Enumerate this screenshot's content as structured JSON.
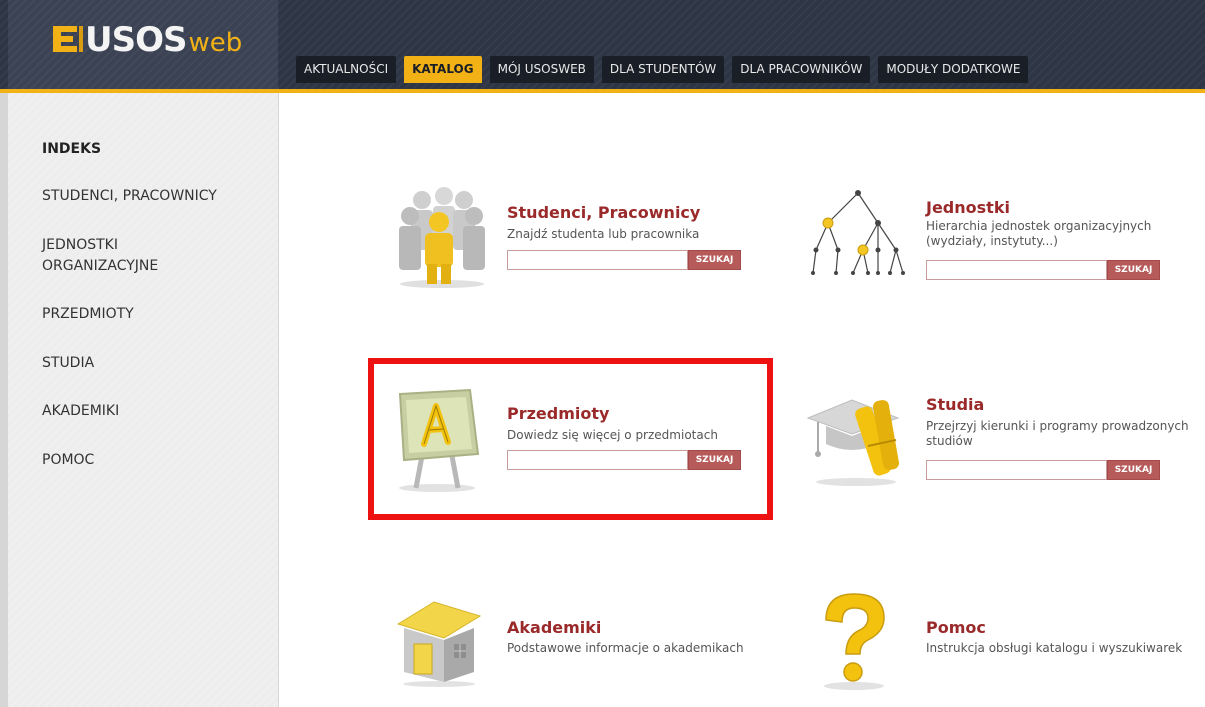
{
  "header": {
    "logo": {
      "main": "USOS",
      "suffix": "web"
    },
    "nav": [
      {
        "label": "AKTUALNOŚCI",
        "active": false
      },
      {
        "label": "KATALOG",
        "active": true
      },
      {
        "label": "MÓJ USOSWEB",
        "active": false
      },
      {
        "label": "DLA STUDENTÓW",
        "active": false
      },
      {
        "label": "DLA PRACOWNIKÓW",
        "active": false
      },
      {
        "label": "MODUŁY DODATKOWE",
        "active": false
      }
    ]
  },
  "sidebar": {
    "items": [
      {
        "label": "INDEKS"
      },
      {
        "label": "STUDENCI, PRACOWNICY"
      },
      {
        "label_line1": "JEDNOSTKI",
        "label_line2": "ORGANIZACYJNE"
      },
      {
        "label": "PRZEDMIOTY"
      },
      {
        "label": "STUDIA"
      },
      {
        "label": "AKADEMIKI"
      },
      {
        "label": "POMOC"
      }
    ]
  },
  "tiles": {
    "studenci": {
      "title": "Studenci, Pracownicy",
      "desc": "Znajdź studenta lub pracownika",
      "search_value": "",
      "button": "SZUKAJ",
      "icon": "people-icon"
    },
    "jednostki": {
      "title": "Jednostki",
      "desc_line1": "Hierarchia jednostek organizacyjnych",
      "desc_line2": "(wydziały, instytuty...)",
      "search_value": "",
      "button": "SZUKAJ",
      "icon": "tree-hierarchy-icon"
    },
    "przedmioty": {
      "title": "Przedmioty",
      "desc": "Dowiedz się więcej o przedmiotach",
      "search_value": "",
      "button": "SZUKAJ",
      "icon": "easel-letter-a-icon"
    },
    "studia": {
      "title": "Studia",
      "desc_line1": "Przejrzyj kierunki i programy prowadzonych",
      "desc_line2": "studiów",
      "search_value": "",
      "button": "SZUKAJ",
      "icon": "graduation-cap-diploma-icon"
    },
    "akademiki": {
      "title": "Akademiki",
      "desc": "Podstawowe informacje o akademikach",
      "icon": "house-icon"
    },
    "pomoc": {
      "title": "Pomoc",
      "desc": "Instrukcja obsługi katalogu i wyszukiwarek",
      "icon": "question-mark-icon"
    }
  },
  "colors": {
    "header_bg": "#2e3544",
    "accent": "#f2b216",
    "title_red": "#9a2a2a",
    "button_bg": "#b65a5a",
    "highlight": "#ee1111"
  }
}
